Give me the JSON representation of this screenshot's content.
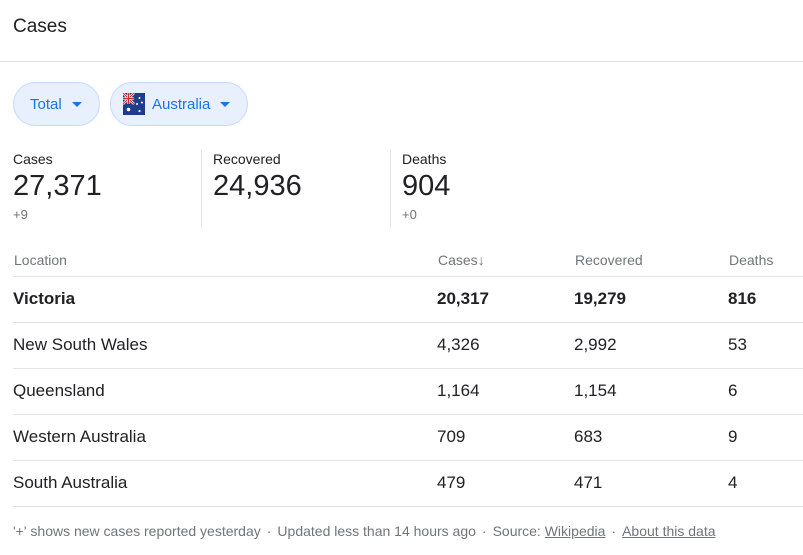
{
  "title": "Cases",
  "filters": {
    "total_label": "Total",
    "country_label": "Australia",
    "country_flag": "australia-flag-icon"
  },
  "stats": [
    {
      "label": "Cases",
      "value": "27,371",
      "delta": "+9"
    },
    {
      "label": "Recovered",
      "value": "24,936",
      "delta": ""
    },
    {
      "label": "Deaths",
      "value": "904",
      "delta": "+0"
    }
  ],
  "table": {
    "headers": {
      "location": "Location",
      "cases": "Cases",
      "recovered": "Recovered",
      "deaths": "Deaths"
    },
    "sort_indicator": "↓",
    "rows": [
      {
        "location": "Victoria",
        "cases": "20,317",
        "recovered": "19,279",
        "deaths": "816"
      },
      {
        "location": "New South Wales",
        "cases": "4,326",
        "recovered": "2,992",
        "deaths": "53"
      },
      {
        "location": "Queensland",
        "cases": "1,164",
        "recovered": "1,154",
        "deaths": "6"
      },
      {
        "location": "Western Australia",
        "cases": "709",
        "recovered": "683",
        "deaths": "9"
      },
      {
        "location": "South Australia",
        "cases": "479",
        "recovered": "471",
        "deaths": "4"
      }
    ]
  },
  "footer": {
    "note": "'+' shows new cases reported yesterday",
    "updated": "Updated less than 14 hours ago",
    "source_label": "Source:",
    "source_link": "Wikipedia",
    "about_link": "About this data",
    "separator": "·"
  },
  "colors": {
    "accent": "#1a73e8",
    "chip_bg": "#e8f0fe",
    "muted": "#70757a",
    "text": "#202124"
  }
}
